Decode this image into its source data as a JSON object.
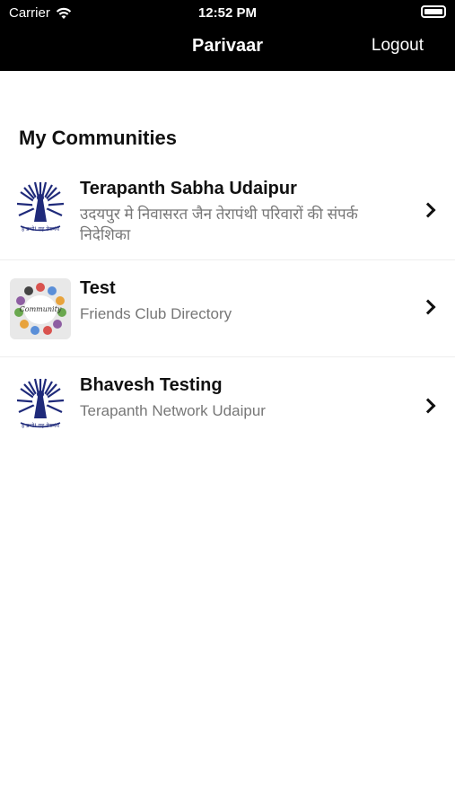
{
  "status": {
    "carrier": "Carrier",
    "time": "12:52 PM"
  },
  "navbar": {
    "title": "Parivaar",
    "logout_label": "Logout"
  },
  "section_title": "My Communities",
  "communities": [
    {
      "name": "Terapanth Sabha Udaipur",
      "subtitle": "उदयपुर मे निवासरत जैन तेरापंथी परिवारों की संपर्क निदेशिका",
      "logo": "terapanth-emblem-icon",
      "logo_caption": "ह प्रभो! यह तेरापंथ"
    },
    {
      "name": "Test",
      "subtitle": "Friends Club Directory",
      "logo": "community-circle-icon",
      "logo_caption": "Community"
    },
    {
      "name": "Bhavesh Testing",
      "subtitle": "Terapanth Network Udaipur",
      "logo": "terapanth-emblem-icon",
      "logo_caption": "ह प्रभो! यह तेरापंथ"
    }
  ],
  "colors": {
    "header_bg": "#000000",
    "accent": "#1f2a7a",
    "subtitle": "#777777"
  }
}
